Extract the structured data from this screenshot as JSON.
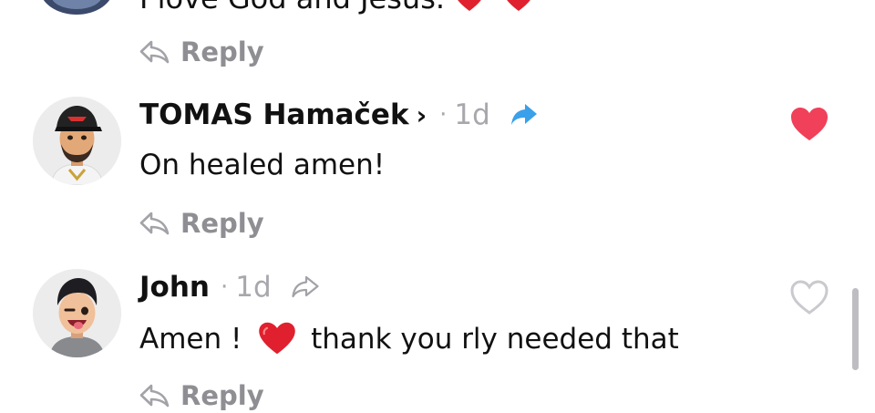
{
  "thread": {
    "clipped_comment": {
      "text": "I love God and Jesus."
    },
    "reply_label": "Reply",
    "comments": [
      {
        "username": "TOMAS Hamaček",
        "chevron": "›",
        "separator": "·",
        "time": "1d",
        "body": "On healed amen!",
        "liked": true,
        "share_icon": "share-filled-blue",
        "like_color": "#f0405a"
      },
      {
        "username": "John",
        "separator": "·",
        "time": "1d",
        "body_before": "Amen !",
        "body_after": "thank you rly needed that",
        "liked": false,
        "share_icon": "share-outline",
        "like_color": "#c9c9ce"
      }
    ]
  }
}
